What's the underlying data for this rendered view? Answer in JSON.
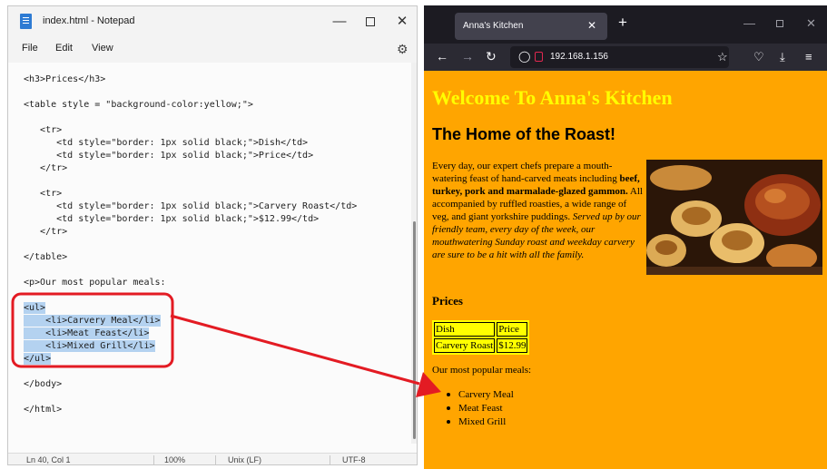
{
  "notepad": {
    "title": "index.html - Notepad",
    "menu": [
      "File",
      "Edit",
      "View"
    ],
    "icons": {
      "file": "notepad-file-icon",
      "settings": "gear-icon",
      "minimize": "minimize-icon",
      "maximize": "maximize-icon",
      "close": "close-icon"
    },
    "lines": [
      "<h3>Prices</h3>",
      "<table style = \"background-color:yellow;\">",
      "   <tr>",
      "      <td style=\"border: 1px solid black;\">Dish</td>",
      "      <td style=\"border: 1px solid black;\">Price</td>",
      "   </tr>",
      "   <tr>",
      "      <td style=\"border: 1px solid black;\">Carvery Roast</td>",
      "      <td style=\"border: 1px solid black;\">$12.99</td>",
      "   </tr>",
      "</table>",
      "<p>Our most popular meals:",
      "<ul>",
      "    <li>Carvery Meal</li>",
      "    <li>Meat Feast</li>",
      "    <li>Mixed Grill</li>",
      "</ul>",
      "</body>",
      "</html>"
    ],
    "status": {
      "position": "Ln 40, Col 1",
      "zoom": "100%",
      "line_endings": "Unix (LF)",
      "encoding": "UTF-8"
    }
  },
  "browser": {
    "tab_title": "Anna's Kitchen",
    "url": "192.168.1.156",
    "icons": {
      "back": "back-arrow-icon",
      "forward": "forward-arrow-icon",
      "reload": "reload-icon",
      "shield": "shield-icon",
      "lock": "lock-icon",
      "star": "star-icon",
      "pocket": "pocket-icon",
      "download": "download-icon",
      "menu": "hamburger-menu-icon"
    }
  },
  "page": {
    "h1": "Welcome To Anna's Kitchen",
    "h2": "The Home of the Roast!",
    "para": {
      "p1": "Every day, our expert chefs prepare a mouth-watering feast of hand-carved meats including ",
      "bold": "beef, turkey, pork and marmalade-glazed gammon.",
      "p2": " All accompanied by ruffled roasties, a wide range of veg, and giant yorkshire puddings. ",
      "italic": "Served up by our friendly team, every day of the week, our mouthwatering Sunday roast and weekday carvery are sure to be a hit with all the family."
    },
    "image_name": "roast-dinner-photo",
    "prices_heading": "Prices",
    "table": {
      "header": [
        "Dish",
        "Price"
      ],
      "row": [
        "Carvery Roast",
        "$12.99"
      ]
    },
    "meals_intro": "Our most popular meals:",
    "meals": [
      "Carvery Meal",
      "Meat Feast",
      "Mixed Grill"
    ]
  },
  "colors": {
    "page_bg": "#ffa500",
    "h1": "#ffff00",
    "table_bg": "#ffff00",
    "highlight": "#e31b23",
    "selection": "#b4d2f0"
  }
}
